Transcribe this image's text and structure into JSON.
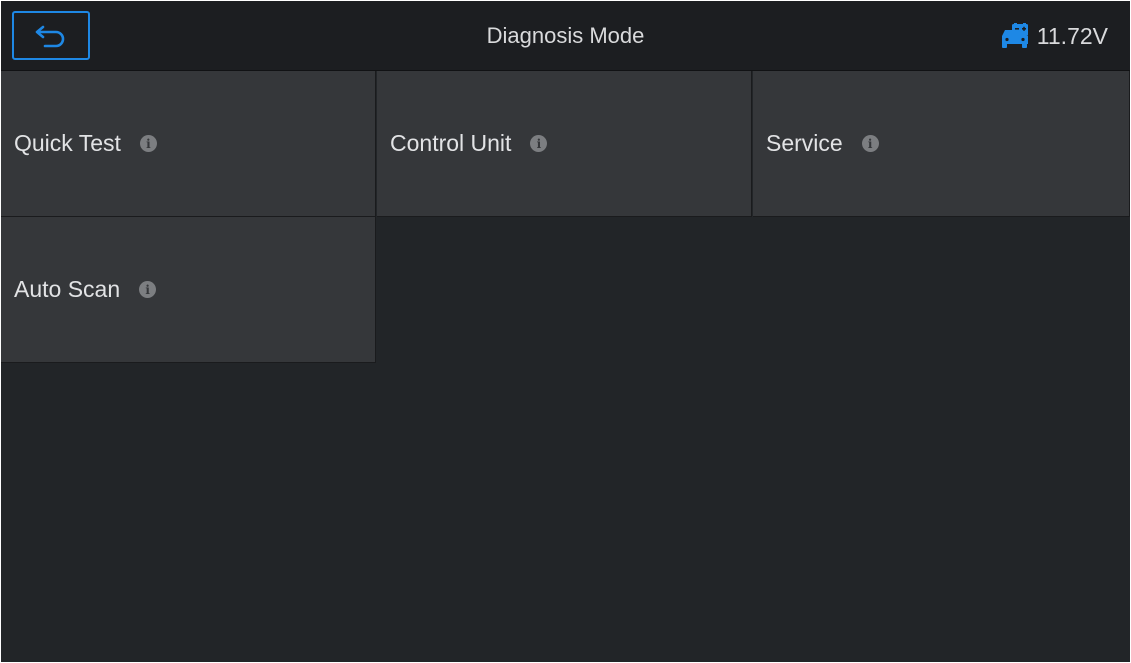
{
  "header": {
    "title": "Diagnosis Mode",
    "voltage": "11.72V",
    "back_icon": "back-arrow-icon",
    "battery_icon": "vehicle-battery-icon",
    "accent_color": "#1e88e5"
  },
  "menu": {
    "items": [
      {
        "label": "Quick Test",
        "icon": "info-icon"
      },
      {
        "label": "Control Unit",
        "icon": "info-icon"
      },
      {
        "label": "Service",
        "icon": "info-icon"
      },
      {
        "label": "Auto Scan",
        "icon": "info-icon"
      }
    ]
  }
}
